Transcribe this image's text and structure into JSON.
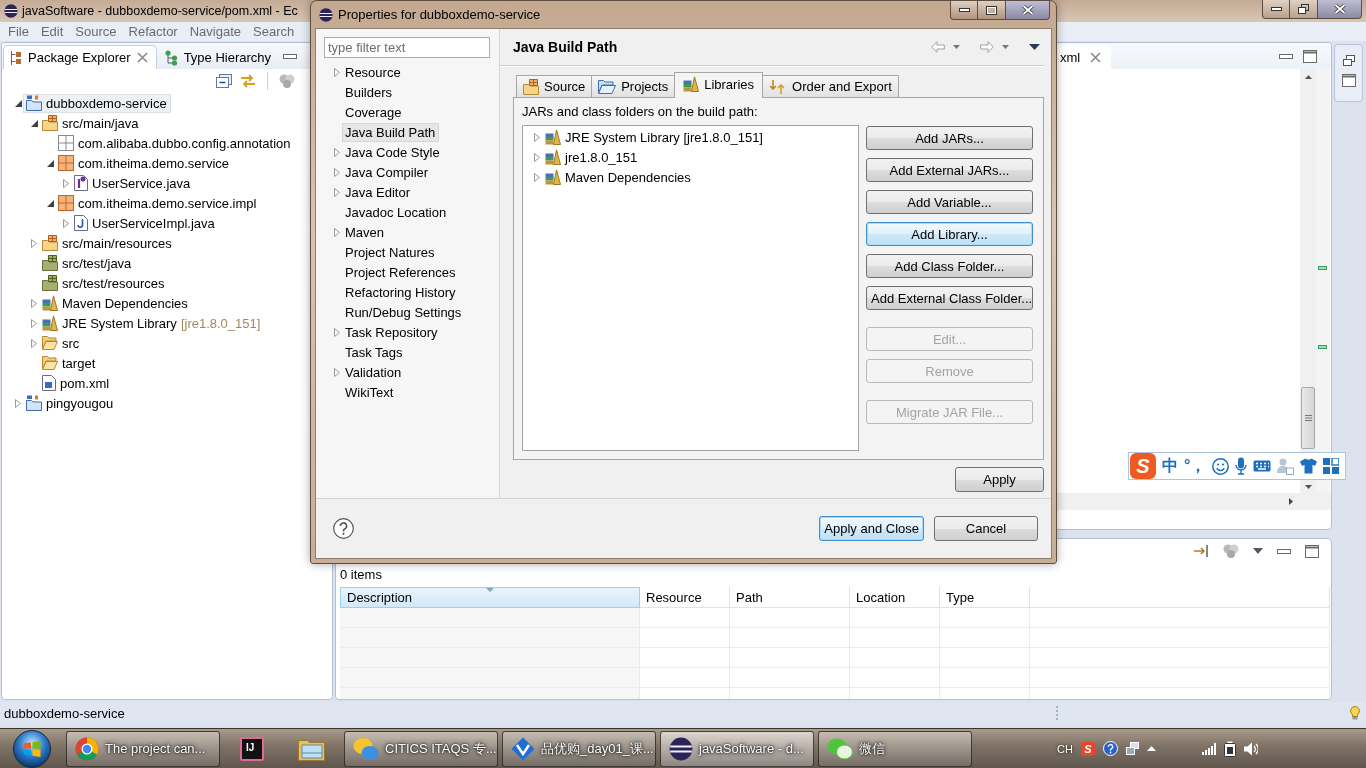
{
  "main_window": {
    "title": "javaSoftware - dubboxdemo-service/pom.xml - Ec",
    "menu": [
      "File",
      "Edit",
      "Source",
      "Refactor",
      "Navigate",
      "Search"
    ],
    "package_explorer": {
      "tabs": [
        {
          "label": "Package Explorer",
          "kind": "explorer",
          "selected": true
        },
        {
          "label": "Type Hierarchy",
          "kind": "hierarchy",
          "selected": false
        }
      ],
      "tree": [
        {
          "label": "dubboxdemo-service",
          "kind": "project",
          "expanded": true,
          "selected": true,
          "children": [
            {
              "label": "src/main/java",
              "kind": "source-folder",
              "expanded": true,
              "selected": false,
              "children": [
                {
                  "label": "com.alibaba.dubbo.config.annotation",
                  "kind": "empty-package",
                  "selected": false
                },
                {
                  "label": "com.itheima.demo.service",
                  "kind": "package",
                  "expanded": true,
                  "selected": false,
                  "children": [
                    {
                      "label": "UserService.java",
                      "kind": "interface-file",
                      "expanded": false,
                      "selected": false
                    }
                  ]
                },
                {
                  "label": "com.itheima.demo.service.impl",
                  "kind": "package",
                  "expanded": true,
                  "selected": false,
                  "children": [
                    {
                      "label": "UserServiceImpl.java",
                      "kind": "class-file",
                      "expanded": false,
                      "selected": false
                    }
                  ]
                }
              ]
            },
            {
              "label": "src/main/resources",
              "kind": "source-folder",
              "expanded": false,
              "selected": false
            },
            {
              "label": "src/test/java",
              "kind": "test-folder",
              "selected": false
            },
            {
              "label": "src/test/resources",
              "kind": "test-folder",
              "selected": false
            },
            {
              "label": "Maven Dependencies",
              "kind": "library",
              "expanded": false,
              "selected": false
            },
            {
              "label": "JRE System Library",
              "qualifier": "[jre1.8.0_151]",
              "kind": "library",
              "expanded": false,
              "selected": false
            },
            {
              "label": "src",
              "kind": "folder",
              "expanded": false,
              "selected": false
            },
            {
              "label": "target",
              "kind": "folder",
              "selected": false
            },
            {
              "label": "pom.xml",
              "kind": "pom-file",
              "selected": false
            }
          ]
        },
        {
          "label": "pingyougou",
          "kind": "project",
          "expanded": false,
          "selected": false
        }
      ]
    },
    "editor": {
      "tab": "xml"
    },
    "problems_view": {
      "summary": "0 items",
      "columns": [
        {
          "label": "Description",
          "sorted": true
        },
        {
          "label": "Resource",
          "sorted": false
        },
        {
          "label": "Path",
          "sorted": false
        },
        {
          "label": "Location",
          "sorted": false
        },
        {
          "label": "Type",
          "sorted": false
        }
      ]
    },
    "status_bar": "dubboxdemo-service"
  },
  "properties_dialog": {
    "title": "Properties for dubboxdemo-service",
    "filter": {
      "placeholder": "type filter text"
    },
    "categories": [
      {
        "label": "Resource",
        "expanded": false,
        "selected": false
      },
      {
        "label": "Builders",
        "selected": false
      },
      {
        "label": "Coverage",
        "selected": false
      },
      {
        "label": "Java Build Path",
        "selected": true
      },
      {
        "label": "Java Code Style",
        "expanded": false,
        "selected": false
      },
      {
        "label": "Java Compiler",
        "expanded": false,
        "selected": false
      },
      {
        "label": "Java Editor",
        "expanded": false,
        "selected": false
      },
      {
        "label": "Javadoc Location",
        "selected": false
      },
      {
        "label": "Maven",
        "expanded": false,
        "selected": false
      },
      {
        "label": "Project Natures",
        "selected": false
      },
      {
        "label": "Project References",
        "selected": false
      },
      {
        "label": "Refactoring History",
        "selected": false
      },
      {
        "label": "Run/Debug Settings",
        "selected": false
      },
      {
        "label": "Task Repository",
        "expanded": false,
        "selected": false
      },
      {
        "label": "Task Tags",
        "selected": false
      },
      {
        "label": "Validation",
        "expanded": false,
        "selected": false
      },
      {
        "label": "WikiText",
        "selected": false
      }
    ],
    "page_title": "Java Build Path",
    "tabs": [
      {
        "label": "Source",
        "kind": "source",
        "selected": false
      },
      {
        "label": "Projects",
        "kind": "projects",
        "selected": false
      },
      {
        "label": "Libraries",
        "kind": "libraries",
        "selected": true
      },
      {
        "label": "Order and Export",
        "kind": "order",
        "selected": false
      }
    ],
    "list_label": "JARs and class folders on the build path:",
    "libraries": [
      {
        "label": "JRE System Library [jre1.8.0_151]",
        "expanded": false,
        "selected": false
      },
      {
        "label": "jre1.8.0_151",
        "expanded": false,
        "selected": false
      },
      {
        "label": "Maven Dependencies",
        "expanded": false,
        "selected": false
      }
    ],
    "button_groups": [
      [
        {
          "label": "Add JARs...",
          "disabled": false,
          "focused": false
        },
        {
          "label": "Add External JARs...",
          "disabled": false,
          "focused": false
        },
        {
          "label": "Add Variable...",
          "disabled": false,
          "focused": false
        },
        {
          "label": "Add Library...",
          "disabled": false,
          "focused": true
        },
        {
          "label": "Add Class Folder...",
          "disabled": false,
          "focused": false
        },
        {
          "label": "Add External Class Folder...",
          "disabled": false,
          "focused": false
        }
      ],
      [
        {
          "label": "Edit...",
          "disabled": true,
          "focused": false
        },
        {
          "label": "Remove",
          "disabled": true,
          "focused": false
        }
      ],
      [
        {
          "label": "Migrate JAR File...",
          "disabled": true,
          "focused": false
        }
      ]
    ],
    "apply_button": "Apply",
    "footer_buttons": [
      {
        "label": "Apply and Close",
        "default": true
      },
      {
        "label": "Cancel",
        "default": false
      }
    ]
  },
  "ime_toolbar": {
    "logo": "S",
    "mode": "中",
    "punctuation": "°，"
  },
  "taskbar": {
    "items": [
      {
        "kind": "browser",
        "label": "The project can...",
        "selected": false
      },
      {
        "kind": "ide",
        "logo": "IJ",
        "selected": false
      },
      {
        "kind": "files",
        "selected": false
      },
      {
        "kind": "chat",
        "label": "CITICS ITAQS 专...",
        "selected": false
      },
      {
        "kind": "document",
        "label": "品优购_day01_课...",
        "selected": false
      },
      {
        "kind": "ide-window",
        "label": "javaSoftware - d...",
        "selected": true
      },
      {
        "kind": "messenger",
        "label": "微信",
        "selected": false
      }
    ],
    "tray": {
      "language": "CH",
      "ime_logo": "S"
    }
  }
}
